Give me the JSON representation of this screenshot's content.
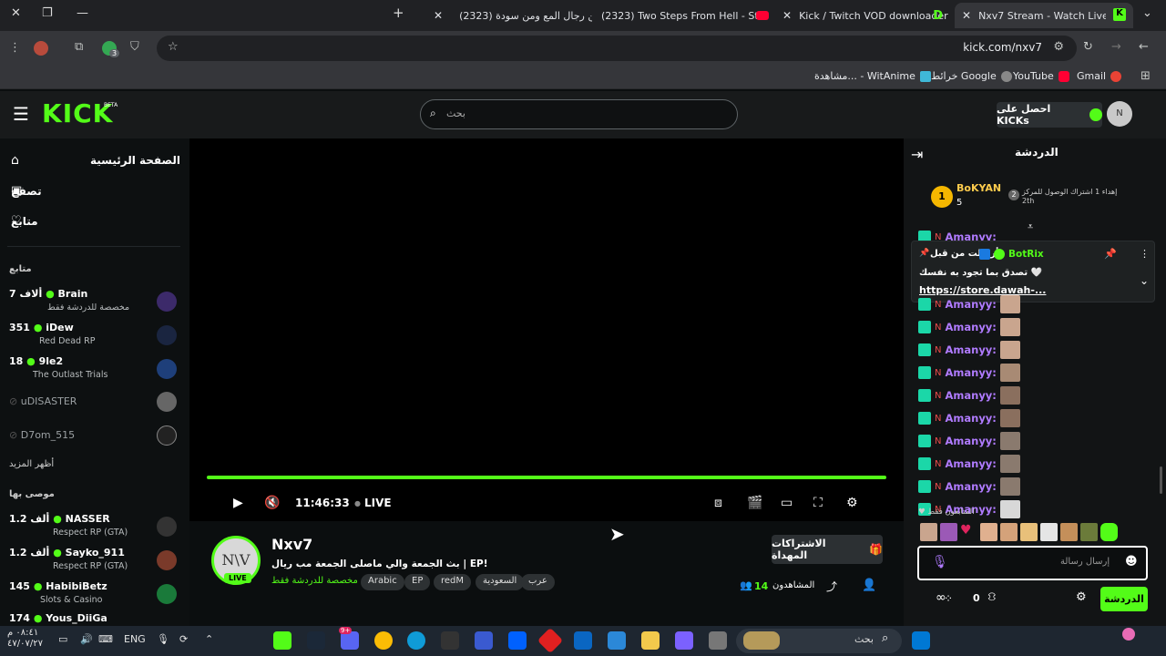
{
  "browser": {
    "tabs": [
      {
        "title": "(2323) من رجال المع ومن سودة"
      },
      {
        "title": "(2323) Two Steps From Hell - St"
      },
      {
        "title": "Kick / Twitch VOD downloader"
      },
      {
        "title": "Nxv7 Stream - Watch Live on Ki"
      }
    ],
    "url": "kick.com/nxv7",
    "bookmarks": [
      "Gmail",
      "YouTube",
      "خرائط Google",
      "مشاهدة... - WitAnime"
    ],
    "extension_badge": "3"
  },
  "header": {
    "logo": "KICK",
    "logo_sup": "BETA",
    "search_placeholder": "بحث",
    "get_kicks": "احصل على KICKs"
  },
  "sidebar": {
    "nav": [
      {
        "label": "الصفحة الرئيسية",
        "icon": "home-icon"
      },
      {
        "label": "تصفح",
        "icon": "browse-icon"
      },
      {
        "label": "متابع",
        "icon": "heart-icon"
      }
    ],
    "following_title": "متابع",
    "following": [
      {
        "name": "Brain",
        "viewers": "7 ألاف",
        "category": "مخصصة للدردشة فقط",
        "live": true
      },
      {
        "name": "iDew",
        "viewers": "351",
        "category": "Red Dead RP",
        "live": true
      },
      {
        "name": "9le2",
        "viewers": "18",
        "category": "The Outlast Trials",
        "live": true
      },
      {
        "name": "uDISASTER",
        "viewers": "",
        "category": "",
        "live": false
      },
      {
        "name": "D7om_515",
        "viewers": "",
        "category": "",
        "live": false
      }
    ],
    "show_more": "أظهر المزيد",
    "recommended_title": "موصى بها",
    "recommended": [
      {
        "name": "NASSER",
        "viewers": "1.2 ألف",
        "category": "Respect RP (GTA)"
      },
      {
        "name": "Sayko_911",
        "viewers": "1.2 ألف",
        "category": "Respect RP (GTA)"
      },
      {
        "name": "HabibiBetz",
        "viewers": "145",
        "category": "Slots & Casino"
      },
      {
        "name": "Yous_DiiGa",
        "viewers": "174",
        "category": ""
      }
    ]
  },
  "player": {
    "time": "11:46:33",
    "live": "LIVE"
  },
  "stream": {
    "avatar_text": "N\\V",
    "live_badge": "LIVE",
    "channel": "Nxv7",
    "title": "بث الجمعة والي ماصلى الجمعة مب ريال | EP!",
    "category": "مخصصة للدردشة فقط",
    "tags": [
      "Arabic",
      "EP",
      "redM",
      "السعودية",
      "عرب"
    ],
    "gift_subs": "الاشتراكات المهداة",
    "viewers_label": "المشاهدون",
    "viewers": "14"
  },
  "chat": {
    "title": "الدردشة",
    "gifter_name": "BoKYAN",
    "gifter_count": "5",
    "gifter_rank": "2",
    "gifter_text": "إهداء 1 اشتراك الوصول للمركز 2th",
    "pinned": {
      "user": "BotRix",
      "label": "أرسلت من قبل",
      "text": "تصدق بما تجود به نفسك 🤍",
      "link": "https://store.dawah-..."
    },
    "messages": [
      "Amanyy:",
      "Amanyy:",
      "Amanyy:",
      "Amanyy:",
      "Amanyy:",
      "Amanyy:",
      "Amanyy:",
      "Amanyy:",
      "Amanyy:",
      "Amanyy:",
      "Amanyy:"
    ],
    "viewers_only": "المتابعون فقط",
    "input_placeholder": "إرسال رسالة",
    "points": "0",
    "send": "الدردشة"
  },
  "taskbar": {
    "search": "بحث",
    "lang": "ENG",
    "time": "٠٨:٤١ م",
    "date": "٤٧/٠٧/٢٧",
    "discord_badge": "9+"
  },
  "colors": {
    "accent": "#53fc18",
    "chat_name": "#b07bff",
    "bg": "#0b0e0f"
  }
}
